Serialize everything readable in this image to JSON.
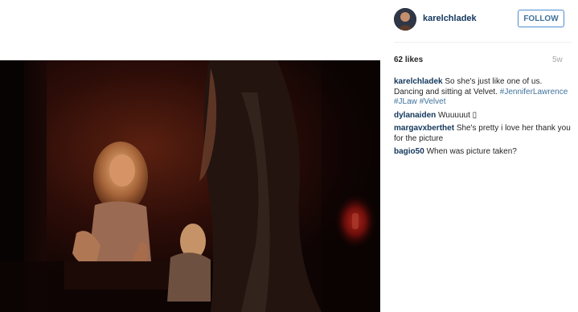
{
  "post": {
    "author": "karelchladek",
    "follow_label": "FOLLOW",
    "likes": "62 likes",
    "age": "5w"
  },
  "caption": {
    "user": "karelchladek",
    "text": "So she's just like one of us. Dancing and sitting at Velvet.",
    "hashtags": [
      "#JenniferLawrence",
      "#JLaw",
      "#Velvet"
    ]
  },
  "comments": [
    {
      "user": "dylanaiden",
      "text": "Wuuuuut ▯"
    },
    {
      "user": "margavxberthet",
      "text": "She's pretty i love her thank you for the picture"
    },
    {
      "user": "bagio50",
      "text": "When was picture taken?"
    }
  ],
  "colors": {
    "link_blue": "#3f729b",
    "username_blue": "#12365c",
    "follow_border": "#4e8dd0",
    "muted_gray": "#a5a7aa"
  }
}
